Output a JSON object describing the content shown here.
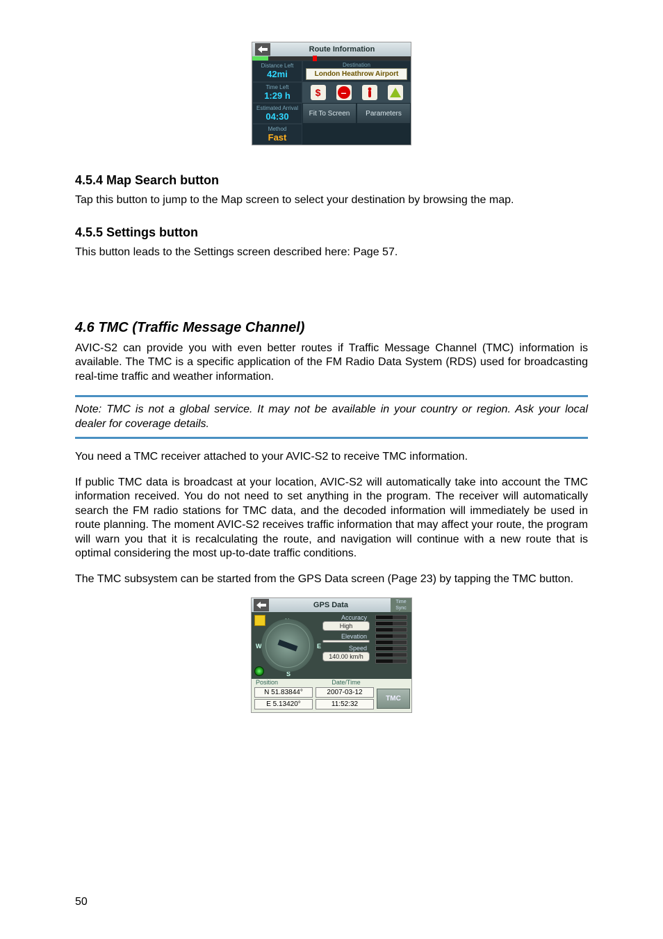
{
  "route_fig": {
    "title": "Route Information",
    "distance": {
      "label": "Distance Left",
      "value": "42mi"
    },
    "destination": {
      "label": "Destination",
      "value": "London Heathrow Airport"
    },
    "time": {
      "label": "Time Left",
      "value": "1:29 h"
    },
    "eta": {
      "label": "Estimated Arrival",
      "value": "04:30"
    },
    "method": {
      "label": "Method",
      "value": "Fast"
    },
    "fit_btn": "Fit To Screen",
    "params_btn": "Parameters",
    "icons": {
      "dollar": "$",
      "noentry": "–",
      "person": "⬤",
      "hazard": "▲"
    }
  },
  "h454": "4.5.4  Map Search button",
  "p454": "Tap this button to jump to the Map screen to select your destination by browsing the map.",
  "h455": "4.5.5  Settings button",
  "p455": "This button leads to the Settings screen described here: Page 57.",
  "h46": "4.6   TMC (Traffic Message Channel)",
  "p46a": "AVIC-S2 can provide you with even better routes if Traffic Message Channel (TMC) information is available. The TMC is a specific application of the FM Radio Data System (RDS) used for broadcasting real-time traffic and weather information.",
  "note46": "Note: TMC is not a global service. It may not be available in your country or region. Ask your local dealer for coverage details.",
  "p46b": "You need a TMC receiver attached to your AVIC-S2 to receive TMC information.",
  "p46c": "If public TMC data is broadcast at your location, AVIC-S2 will automatically take into account the TMC information received. You do not need to set anything in the program. The receiver will automatically search the FM radio stations for TMC data, and the decoded information will immediately be used in route planning. The moment AVIC-S2 receives traffic information that may affect your route, the program will warn you that it is recalculating the route, and navigation will continue with a new route that is optimal considering the most up-to-date traffic conditions.",
  "p46d": "The TMC subsystem can be started from the GPS Data screen (Page 23) by tapping the TMC button.",
  "gps_fig": {
    "title": "GPS Data",
    "sync": "Time Sync",
    "accuracy": {
      "label": "Accuracy",
      "value": "High"
    },
    "elevation": {
      "label": "Elevation",
      "value": ""
    },
    "speed": {
      "label": "Speed",
      "value": "140.00 km/h"
    },
    "compass": {
      "n": "N",
      "s": "S",
      "e": "E",
      "w": "W"
    },
    "position_label": "Position",
    "datetime_label": "Date/Time",
    "lat": "N 51.83844°",
    "lon": "E 5.13420°",
    "date": "2007-03-12",
    "time": "11:52:32",
    "tmc_btn": "TMC"
  },
  "page_number": "50"
}
